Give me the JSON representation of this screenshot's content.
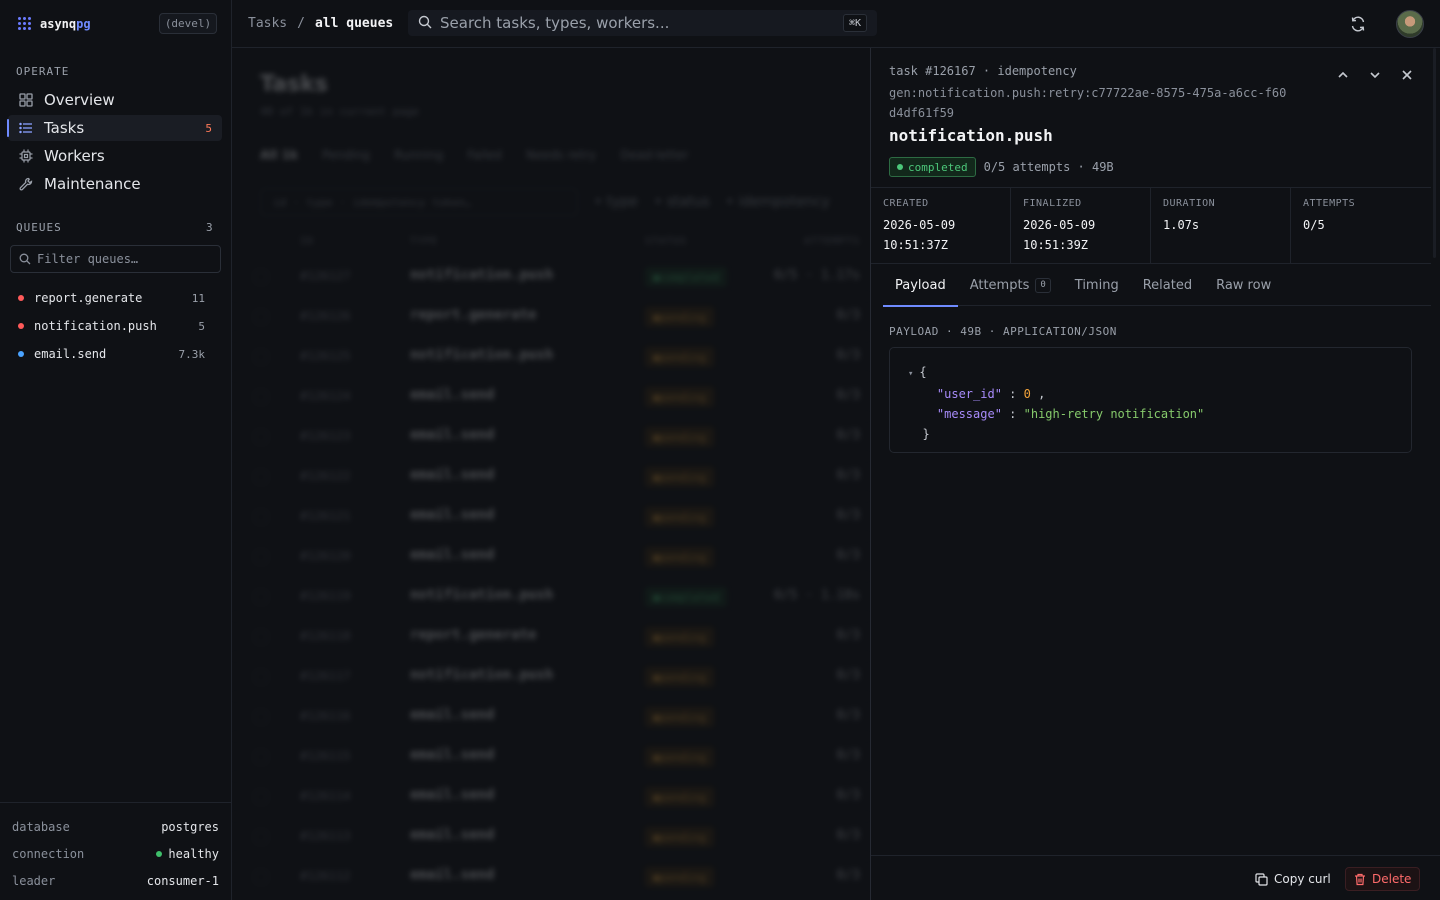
{
  "brand": {
    "name_prefix": "asynq",
    "name_suffix": "pg",
    "env": "(devel)"
  },
  "sidebar": {
    "operate_label": "OPERATE",
    "nav": [
      {
        "label": "Overview",
        "icon": "grid-icon"
      },
      {
        "label": "Tasks",
        "icon": "list-icon",
        "count": "5",
        "active": true
      },
      {
        "label": "Workers",
        "icon": "cpu-icon"
      },
      {
        "label": "Maintenance",
        "icon": "wrench-icon"
      }
    ],
    "queues_label": "QUEUES",
    "queues_count": "3",
    "filter_placeholder": "Filter queues…",
    "queues": [
      {
        "name": "report.generate",
        "count": "11",
        "color": "#ff5a5a"
      },
      {
        "name": "notification.push",
        "count": "5",
        "color": "#ff5a5a"
      },
      {
        "name": "email.send",
        "count": "7.3k",
        "color": "#4aa3ff"
      }
    ],
    "footer": [
      {
        "key": "database",
        "value": "postgres"
      },
      {
        "key": "connection",
        "value": "healthy"
      },
      {
        "key": "leader",
        "value": "consumer-1"
      }
    ]
  },
  "topbar": {
    "crumb_root": "Tasks",
    "crumb_sep": "/",
    "crumb_current": "all queues",
    "search_placeholder": "Search tasks, types, workers...",
    "shortcut": "⌘K"
  },
  "main": {
    "title": "Tasks",
    "subtitle": "40 of 1k in current page",
    "tabs": [
      "All 1k",
      "Pending",
      "Running",
      "Failed",
      "Needs retry",
      "Dead-letter"
    ],
    "filter_placeholder": "id · type · idempotency token…",
    "chips": [
      "type",
      "status",
      "idempotency"
    ],
    "columns": [
      "ID",
      "TYPE",
      "STATUS",
      "ATTEMPTS"
    ],
    "rows": [
      {
        "id": "#126127",
        "type": "notification.push",
        "status": "completed",
        "attempts": "0/5 · 1.17s"
      },
      {
        "id": "#126126",
        "type": "report.generate",
        "status": "pending",
        "attempts": "0/3"
      },
      {
        "id": "#126125",
        "type": "notification.push",
        "status": "pending",
        "attempts": "0/3"
      },
      {
        "id": "#126124",
        "type": "email.send",
        "status": "pending",
        "attempts": "0/3"
      },
      {
        "id": "#126123",
        "type": "email.send",
        "status": "pending",
        "attempts": "0/3"
      },
      {
        "id": "#126122",
        "type": "email.send",
        "status": "pending",
        "attempts": "0/3"
      },
      {
        "id": "#126121",
        "type": "email.send",
        "status": "pending",
        "attempts": "0/3"
      },
      {
        "id": "#126120",
        "type": "email.send",
        "status": "pending",
        "attempts": "0/3"
      },
      {
        "id": "#126119",
        "type": "notification.push",
        "status": "completed",
        "attempts": "0/5 · 1.18s"
      },
      {
        "id": "#126118",
        "type": "report.generate",
        "status": "pending",
        "attempts": "0/3"
      },
      {
        "id": "#126117",
        "type": "notification.push",
        "status": "pending",
        "attempts": "0/3"
      },
      {
        "id": "#126116",
        "type": "email.send",
        "status": "pending",
        "attempts": "0/3"
      },
      {
        "id": "#126115",
        "type": "email.send",
        "status": "pending",
        "attempts": "0/3"
      },
      {
        "id": "#126114",
        "type": "email.send",
        "status": "pending",
        "attempts": "0/3"
      },
      {
        "id": "#126113",
        "type": "email.send",
        "status": "pending",
        "attempts": "0/3"
      },
      {
        "id": "#126112",
        "type": "email.send",
        "status": "pending",
        "attempts": "0/3"
      }
    ]
  },
  "detail": {
    "id_line": "task #126167 · idempotency",
    "key": "gen:notification.push:retry:c77722ae-8575-475a-a6cc-f60d4df61f59",
    "title": "notification.push",
    "status": "completed",
    "summary": "0/5 attempts · 49B",
    "meta": [
      {
        "label": "CREATED",
        "value": "2026-05-09\n10:51:37Z"
      },
      {
        "label": "FINALIZED",
        "value": "2026-05-09\n10:51:39Z"
      },
      {
        "label": "DURATION",
        "value": "1.07s"
      },
      {
        "label": "ATTEMPTS",
        "value": "0/5"
      }
    ],
    "tabs": [
      {
        "label": "Payload",
        "active": true
      },
      {
        "label": "Attempts",
        "count": "0"
      },
      {
        "label": "Timing"
      },
      {
        "label": "Related"
      },
      {
        "label": "Raw row"
      }
    ],
    "payload_header": "PAYLOAD · 49B · APPLICATION/JSON",
    "payload": {
      "open": "{",
      "close": "}",
      "k1": "\"user_id\"",
      "v1": "0",
      "k2": "\"message\"",
      "v2": "\"high-retry notification\""
    },
    "copy_label": "Copy curl",
    "delete_label": "Delete"
  }
}
